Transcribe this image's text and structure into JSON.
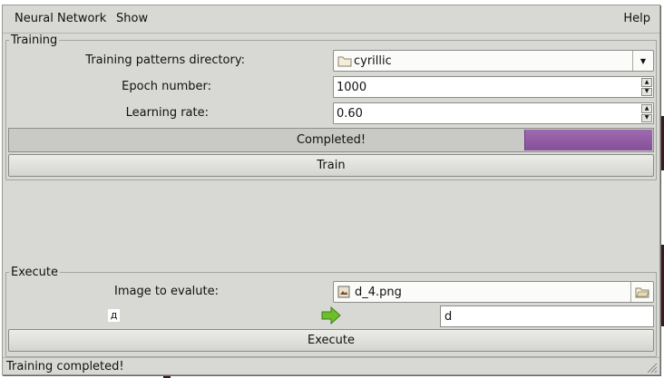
{
  "menubar": {
    "items": [
      {
        "label": "Neural Network"
      },
      {
        "label": "Show"
      }
    ],
    "help_label": "Help"
  },
  "training": {
    "legend": "Training",
    "directory_label": "Training patterns directory:",
    "directory_value": "cyrillic",
    "epoch_label": "Epoch number:",
    "epoch_value": "1000",
    "rate_label": "Learning rate:",
    "rate_value": "0.60",
    "progress_text": "Completed!",
    "progress_fraction": 1.0,
    "train_button": "Train"
  },
  "execute": {
    "legend": "Execute",
    "image_label": "Image to evalute:",
    "image_file": "d_4.png",
    "input_glyph": "д",
    "result_value": "d",
    "execute_button": "Execute"
  },
  "status": {
    "text": "Training completed!"
  },
  "colors": {
    "progress_fill": "#8f5aa3",
    "arrow_green": "#5aa61e"
  },
  "icons": [
    "folder-icon",
    "image-file-icon",
    "folder-open-icon",
    "green-arrow-icon",
    "resize-grip-icon"
  ]
}
